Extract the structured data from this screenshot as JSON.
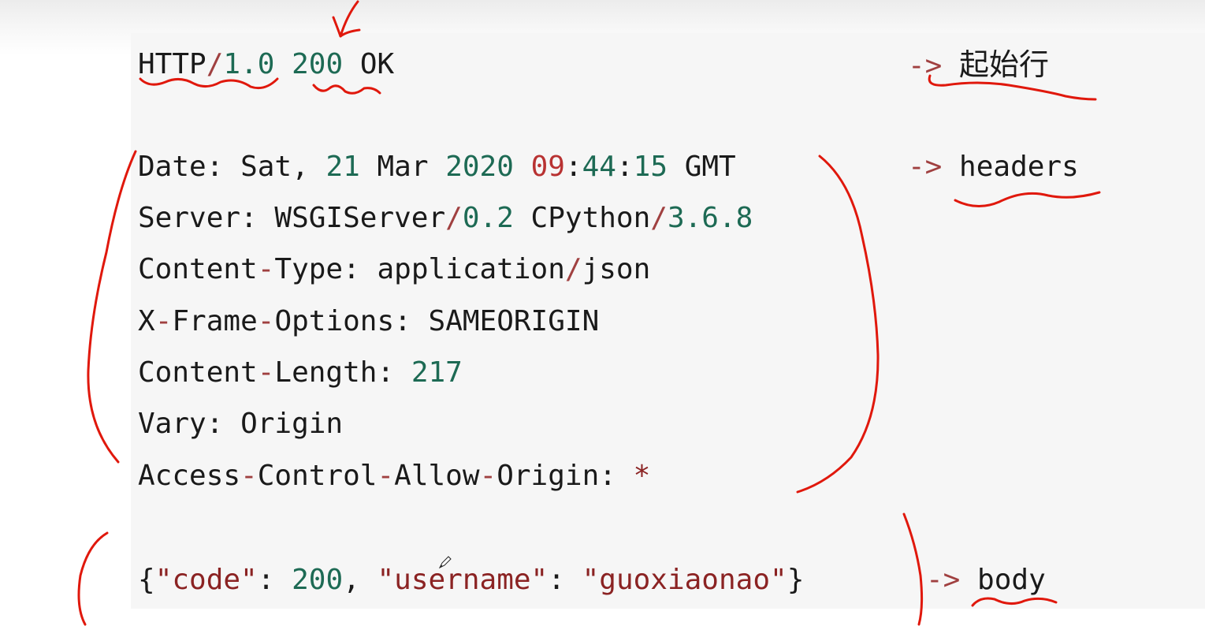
{
  "status_line": {
    "protocol": "HTTP",
    "slash": "/",
    "version": "1.0",
    "code": "200",
    "reason": "OK"
  },
  "headers": [
    {
      "parts": [
        {
          "t": "Date",
          "c": "key"
        },
        {
          "t": ": ",
          "c": "punct"
        },
        {
          "t": "Sat",
          "c": "key"
        },
        {
          "t": ", ",
          "c": "punct"
        },
        {
          "t": "21",
          "c": "num"
        },
        {
          "t": " Mar ",
          "c": "key"
        },
        {
          "t": "2020",
          "c": "num"
        },
        {
          "t": " ",
          "c": "punct"
        },
        {
          "t": "09",
          "c": "red"
        },
        {
          "t": ":",
          "c": "punct"
        },
        {
          "t": "44",
          "c": "num"
        },
        {
          "t": ":",
          "c": "punct"
        },
        {
          "t": "15",
          "c": "num"
        },
        {
          "t": " GMT",
          "c": "key"
        }
      ]
    },
    {
      "parts": [
        {
          "t": "Server",
          "c": "key"
        },
        {
          "t": ": ",
          "c": "punct"
        },
        {
          "t": "WSGIServer",
          "c": "key"
        },
        {
          "t": "/",
          "c": "op"
        },
        {
          "t": "0.2",
          "c": "num"
        },
        {
          "t": " CPython",
          "c": "key"
        },
        {
          "t": "/",
          "c": "op"
        },
        {
          "t": "3.6.8",
          "c": "num"
        }
      ]
    },
    {
      "parts": [
        {
          "t": "Content",
          "c": "key"
        },
        {
          "t": "-",
          "c": "op"
        },
        {
          "t": "Type",
          "c": "key"
        },
        {
          "t": ": ",
          "c": "punct"
        },
        {
          "t": "application",
          "c": "key"
        },
        {
          "t": "/",
          "c": "op"
        },
        {
          "t": "json",
          "c": "key"
        }
      ]
    },
    {
      "parts": [
        {
          "t": "X",
          "c": "key"
        },
        {
          "t": "-",
          "c": "op"
        },
        {
          "t": "Frame",
          "c": "key"
        },
        {
          "t": "-",
          "c": "op"
        },
        {
          "t": "Options",
          "c": "key"
        },
        {
          "t": ": ",
          "c": "punct"
        },
        {
          "t": "SAMEORIGIN",
          "c": "key"
        }
      ]
    },
    {
      "parts": [
        {
          "t": "Content",
          "c": "key"
        },
        {
          "t": "-",
          "c": "op"
        },
        {
          "t": "Length",
          "c": "key"
        },
        {
          "t": ": ",
          "c": "punct"
        },
        {
          "t": "217",
          "c": "num"
        }
      ]
    },
    {
      "parts": [
        {
          "t": "Vary",
          "c": "key"
        },
        {
          "t": ": ",
          "c": "punct"
        },
        {
          "t": "Origin",
          "c": "key"
        }
      ]
    },
    {
      "parts": [
        {
          "t": "Access",
          "c": "key"
        },
        {
          "t": "-",
          "c": "op"
        },
        {
          "t": "Control",
          "c": "key"
        },
        {
          "t": "-",
          "c": "op"
        },
        {
          "t": "Allow",
          "c": "key"
        },
        {
          "t": "-",
          "c": "op"
        },
        {
          "t": "Origin",
          "c": "key"
        },
        {
          "t": ": ",
          "c": "punct"
        },
        {
          "t": "*",
          "c": "str"
        }
      ]
    }
  ],
  "body_line": {
    "parts": [
      {
        "t": "{",
        "c": "punct"
      },
      {
        "t": "\"code\"",
        "c": "str"
      },
      {
        "t": ": ",
        "c": "punct"
      },
      {
        "t": "200",
        "c": "num"
      },
      {
        "t": ", ",
        "c": "punct"
      },
      {
        "t": "\"username\"",
        "c": "str"
      },
      {
        "t": ": ",
        "c": "punct"
      },
      {
        "t": "\"guoxiaonao\"",
        "c": "str"
      },
      {
        "t": "}",
        "c": "punct"
      }
    ]
  },
  "annotations": {
    "arrow": "->",
    "start_line_label": "起始行",
    "headers_label": "headers",
    "body_label": "body"
  },
  "colors": {
    "ink": "#e0180c",
    "number": "#1d6a54",
    "string": "#8b2323",
    "operator": "#a04040"
  }
}
